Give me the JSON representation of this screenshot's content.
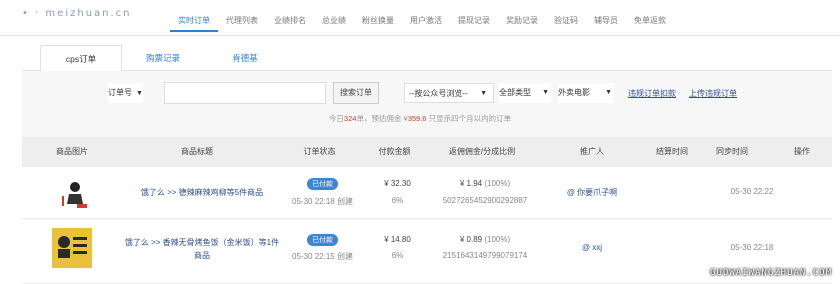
{
  "logo": "• · meizhuan.cn",
  "nav": [
    "实时订单",
    "代理列表",
    "业绩排名",
    "总业绩",
    "粉丝换量",
    "用户激活",
    "提现记录",
    "奖励记录",
    "验证码",
    "辅导员",
    "免单返款"
  ],
  "tabs": [
    "cps订单",
    "购票记录",
    "肯德基"
  ],
  "filters": {
    "order_type": "订单号",
    "search_placeholder": "",
    "search_button": "搜索订单",
    "account_filter": "--按公众号浏览--",
    "category_filter": "全部类型",
    "vendor_filter": "外卖电影",
    "link1": "违规订单扣款",
    "link2": "上传违规订单"
  },
  "summary": {
    "prefix": "今日",
    "count": "324",
    "mid": "单，预估佣金 ¥",
    "amount": "359.6",
    "suffix": " 只显示四个月以内的订单"
  },
  "table": {
    "headers": [
      "商品图片",
      "商品标题",
      "订单状态",
      "付款金额",
      "返佣佣金/分成比例",
      "推广人",
      "结算时间",
      "同步时间",
      "操作"
    ],
    "rows": [
      {
        "title": "饿了么 >> 德辣麻辣鸡柳等5件商品",
        "status": "已付款",
        "created": "05-30 22:18 创建",
        "amount": "¥ 32.30",
        "ratio": "6%",
        "commission": "¥ 1.94",
        "commission_pct": "(100%)",
        "order_no": "5027265452900292887",
        "promoter": "@ 你要爪子啊",
        "settle_time": "",
        "sync_time": "05-30 22:22"
      },
      {
        "title": "饿了么 >> 香辣无骨烤鱼饭（金米饭）等1件商品",
        "status": "已付款",
        "created": "05-30 22:15 创建",
        "amount": "¥ 14.80",
        "ratio": "6%",
        "commission": "¥ 0.89",
        "commission_pct": "(100%)",
        "order_no": "2151643149799079174",
        "promoter": "@ xxj",
        "settle_time": "",
        "sync_time": "05-30 22:18"
      }
    ]
  },
  "watermark": "GUOWAIWANGZHUAN.COM",
  "colors": {
    "accent": "#2e7fd6",
    "highlight": "#d23c2c",
    "badge": "#3b86d6"
  }
}
